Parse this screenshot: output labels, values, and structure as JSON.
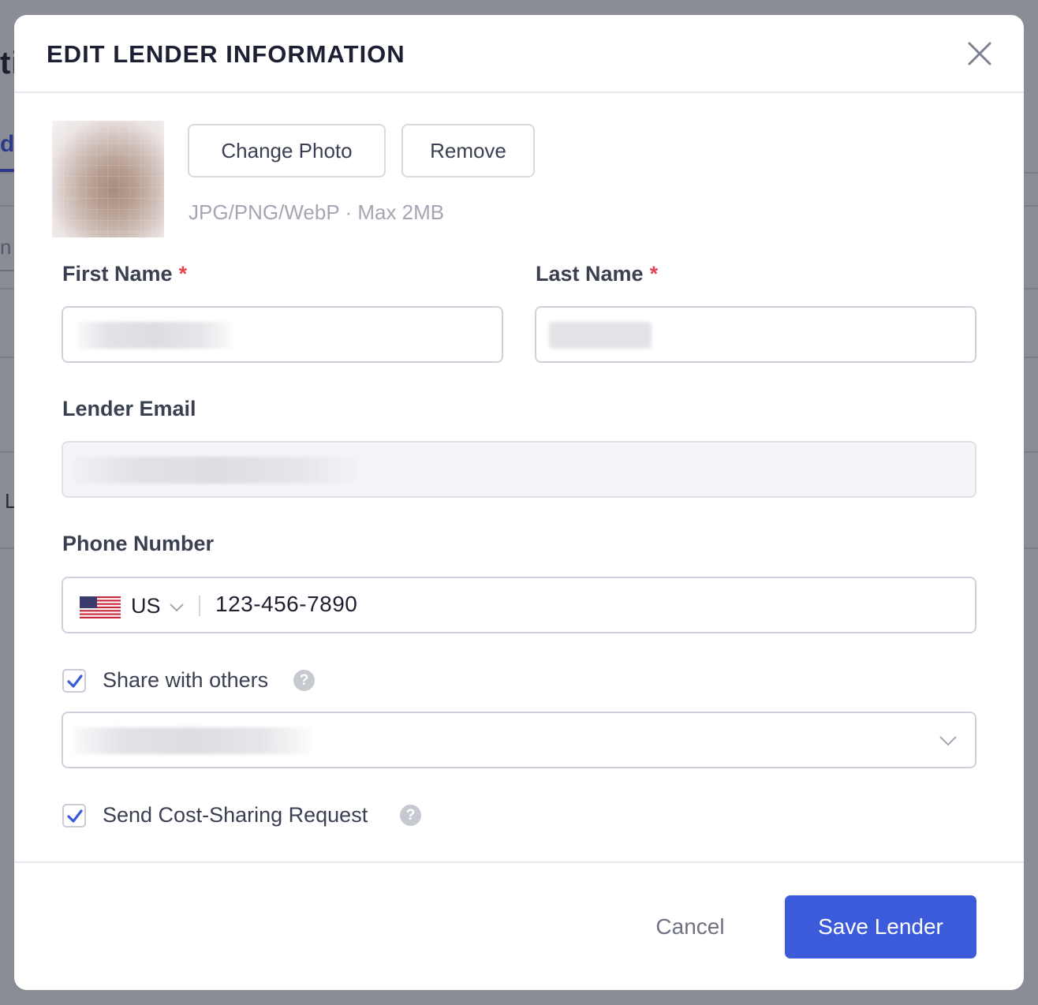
{
  "background": {
    "title_fragment": "ti",
    "tab_fragment": "d",
    "input_fragment": "n",
    "row_fragment": "L"
  },
  "modal": {
    "title": "EDIT LENDER INFORMATION",
    "close_icon": "close-icon"
  },
  "photo": {
    "change_label": "Change Photo",
    "remove_label": "Remove",
    "hint": "JPG/PNG/WebP · Max 2MB"
  },
  "form": {
    "first_name": {
      "label": "First Name",
      "required_mark": "*"
    },
    "last_name": {
      "label": "Last Name",
      "required_mark": "*"
    },
    "email": {
      "label": "Lender Email"
    },
    "phone": {
      "label": "Phone Number",
      "country_code": "US",
      "flag_icon": "us-flag-icon",
      "value": "123-456-7890"
    },
    "share": {
      "label": "Share with others",
      "checked": true,
      "help": "?"
    },
    "cost_sharing": {
      "label": "Send Cost-Sharing Request",
      "checked": true,
      "help": "?"
    }
  },
  "footer": {
    "cancel_label": "Cancel",
    "save_label": "Save Lender"
  },
  "colors": {
    "primary": "#3b5bdb",
    "required": "#e0464c",
    "overlay": "#8b8d96"
  }
}
